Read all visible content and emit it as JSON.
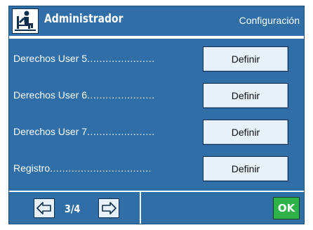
{
  "header": {
    "title": "Administrador",
    "subtitle": "Configuración",
    "icon": "administrator-person-icon"
  },
  "rows": [
    {
      "label": "Derechos User 5",
      "dots": "......................",
      "button": "Definir"
    },
    {
      "label": "Derechos User 6",
      "dots": "......................",
      "button": "Definir"
    },
    {
      "label": "Derechos User 7",
      "dots": "......................",
      "button": "Definir"
    },
    {
      "label": "Registro",
      "dots": ".................................",
      "button": "Definir"
    }
  ],
  "footer": {
    "page": "3/4",
    "ok_label": "OK",
    "prev_icon": "arrow-left-icon",
    "next_icon": "arrow-right-icon"
  },
  "colors": {
    "background": "#2f6ea6",
    "button": "#e6f1fa",
    "ok_button": "#2db34a",
    "text": "#ffffff"
  }
}
